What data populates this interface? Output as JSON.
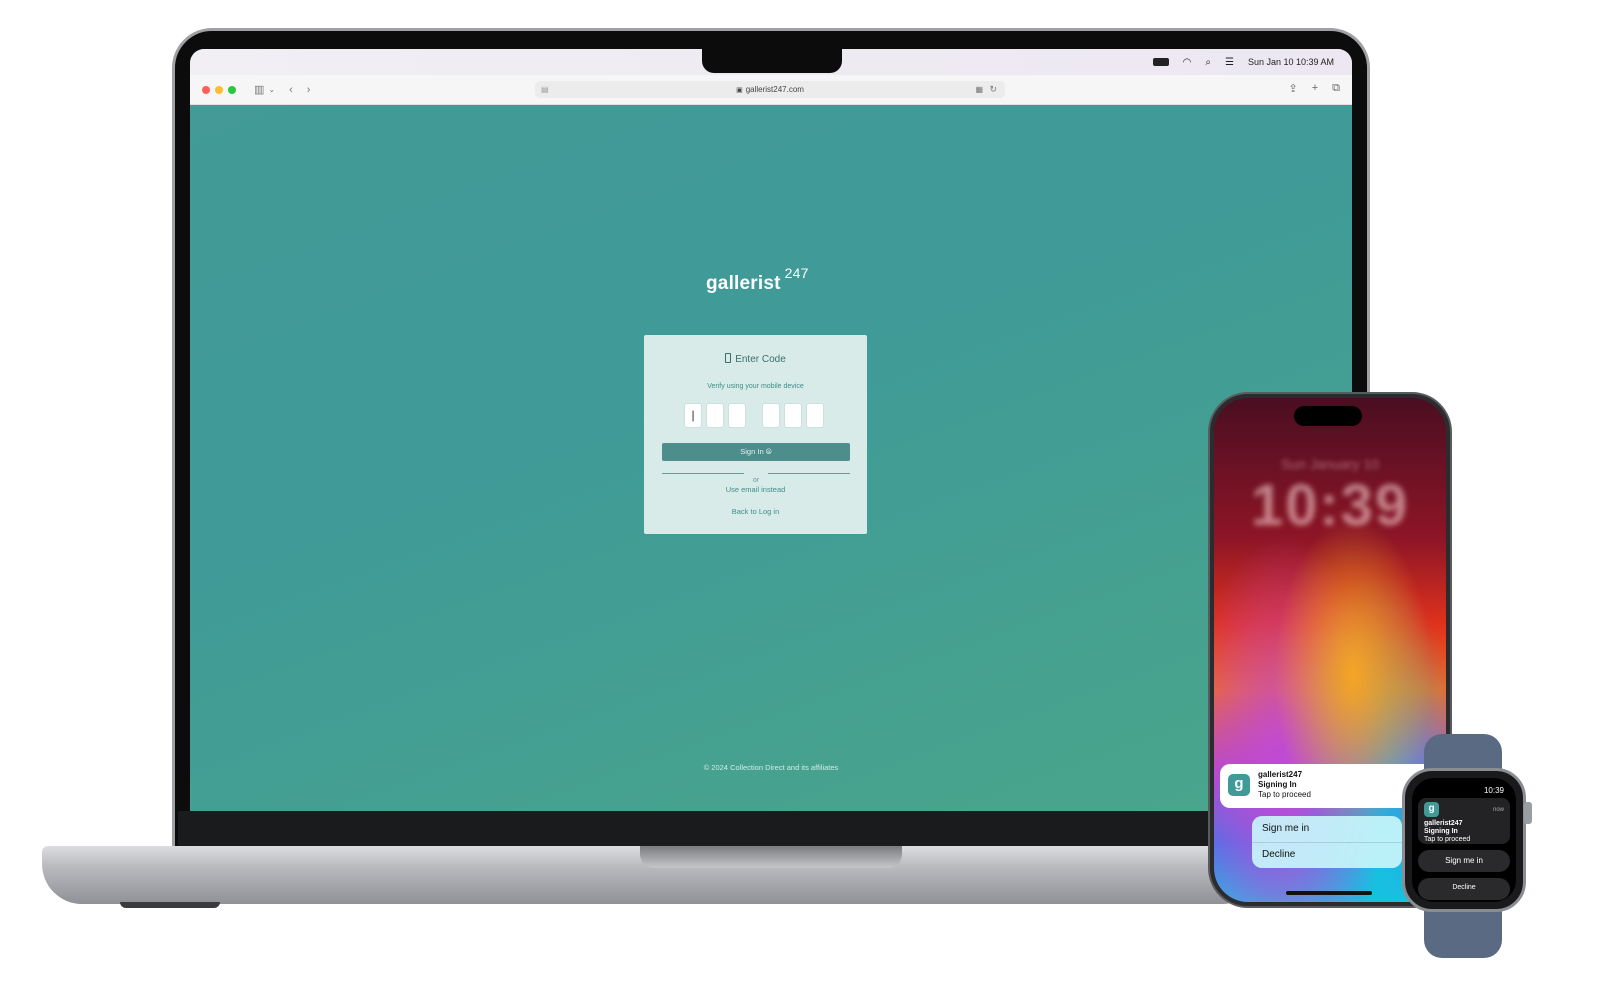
{
  "menubar": {
    "datetime": "Sun Jan 10  10:39 AM"
  },
  "browser": {
    "url": "gallerist247.com",
    "lock_icon": "lock-icon"
  },
  "page": {
    "brand_name": "gallerist",
    "brand_sup": "247",
    "card": {
      "title": "Enter Code",
      "subtitle": "Verify using your mobile device",
      "code_digits": [
        "|",
        "",
        "",
        "",
        "",
        ""
      ],
      "sign_in_label": "Sign In",
      "divider_text": "or",
      "email_link": "Use email instead",
      "back_link": "Back to Log in"
    },
    "footer": "© 2024 Collection Direct and its affiliates"
  },
  "phone": {
    "lock_time": "10:39",
    "lock_date": "Sun January 10",
    "notification": {
      "app_icon_letter": "g",
      "app_name": "gallerist247",
      "title": "Signing In",
      "body": "Tap to proceed"
    },
    "actions": {
      "sign_me_in": "Sign me in",
      "decline": "Decline"
    }
  },
  "watch": {
    "time": "10:39",
    "app_icon_letter": "g",
    "now": "now",
    "app_name": "gallerist247",
    "title": "Signing In",
    "body": "Tap to proceed",
    "sign_me_in": "Sign me in",
    "decline": "Decline"
  },
  "colors": {
    "page_bg": "#3f9a98",
    "card_bg": "#d8ebe8",
    "button_bg": "#4d8e8c",
    "app_icon": "#3f9a98"
  }
}
